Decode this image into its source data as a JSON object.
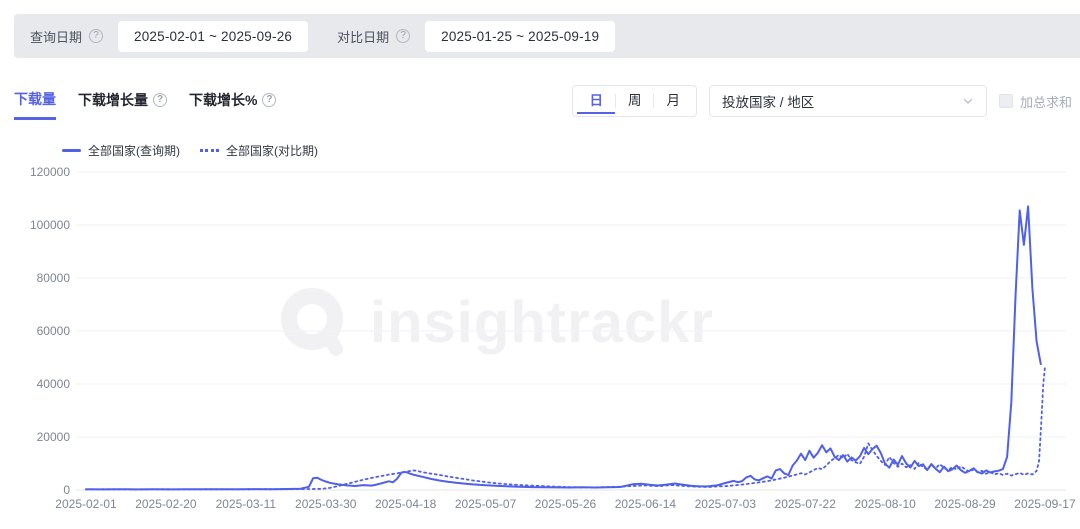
{
  "colors": {
    "accent": "#5663e6",
    "line": "#5060e8",
    "topbar_bg": "#e8e9ec",
    "grid": "#f1f2f5",
    "axis_text": "#7e8594",
    "watermark": "#f1f1f3"
  },
  "filters": {
    "query_label": "查询日期",
    "query_value": "2025-02-01  ~  2025-09-26",
    "compare_label": "对比日期",
    "compare_value": "2025-01-25  ~  2025-09-19"
  },
  "toolbar": {
    "tabs": [
      {
        "label": "下载量",
        "active": true,
        "has_help": false
      },
      {
        "label": "下载增长量",
        "active": false,
        "has_help": true
      },
      {
        "label": "下载增长%",
        "active": false,
        "has_help": true
      }
    ],
    "granularity": [
      {
        "label": "日",
        "active": true
      },
      {
        "label": "周",
        "active": false
      },
      {
        "label": "月",
        "active": false
      }
    ],
    "country_dropdown_placeholder": "投放国家 / 地区",
    "sum_checkbox_label": "加总求和",
    "sum_checkbox_checked": false
  },
  "legend": [
    {
      "label": "全部国家(查询期)",
      "style": "solid"
    },
    {
      "label": "全部国家(对比期)",
      "style": "dotted"
    }
  ],
  "watermark": "insightrackr",
  "chart_data": {
    "type": "line",
    "title": "",
    "xlabel": "",
    "ylabel": "",
    "grid": true,
    "legend_position": "top-left",
    "x_axis": {
      "unit": "day index from 2025-02-01",
      "domain": [
        0,
        233
      ],
      "tick_days": [
        0,
        19,
        38,
        57,
        76,
        95,
        114,
        133,
        152,
        171,
        190,
        209,
        228
      ],
      "tick_labels": [
        "2025-02-01",
        "2025-02-20",
        "2025-03-11",
        "2025-03-30",
        "2025-04-18",
        "2025-05-07",
        "2025-05-26",
        "2025-06-14",
        "2025-07-03",
        "2025-07-22",
        "2025-08-10",
        "2025-08-29",
        "2025-09-17"
      ]
    },
    "y_axis": {
      "range": [
        0,
        120000
      ],
      "ticks": [
        0,
        20000,
        40000,
        60000,
        80000,
        100000,
        120000
      ]
    },
    "series": [
      {
        "name": "全部国家(查询期)",
        "style": "solid",
        "points": [
          [
            0,
            260
          ],
          [
            4,
            210
          ],
          [
            8,
            300
          ],
          [
            12,
            240
          ],
          [
            16,
            280
          ],
          [
            20,
            220
          ],
          [
            24,
            300
          ],
          [
            28,
            260
          ],
          [
            32,
            310
          ],
          [
            36,
            280
          ],
          [
            40,
            340
          ],
          [
            44,
            300
          ],
          [
            48,
            380
          ],
          [
            51,
            500
          ],
          [
            53,
            1200
          ],
          [
            54,
            4400
          ],
          [
            55,
            4600
          ],
          [
            56,
            3800
          ],
          [
            57,
            3200
          ],
          [
            58,
            2700
          ],
          [
            60,
            2100
          ],
          [
            62,
            1750
          ],
          [
            64,
            1500
          ],
          [
            66,
            1850
          ],
          [
            68,
            1650
          ],
          [
            70,
            2400
          ],
          [
            72,
            3300
          ],
          [
            73,
            2900
          ],
          [
            74,
            4300
          ],
          [
            75,
            6600
          ],
          [
            76,
            6800
          ],
          [
            77,
            6200
          ],
          [
            78,
            5700
          ],
          [
            80,
            5000
          ],
          [
            82,
            4200
          ],
          [
            84,
            3600
          ],
          [
            86,
            3100
          ],
          [
            88,
            2700
          ],
          [
            90,
            2400
          ],
          [
            92,
            2100
          ],
          [
            95,
            1800
          ],
          [
            98,
            1550
          ],
          [
            100,
            1400
          ],
          [
            103,
            1250
          ],
          [
            106,
            1100
          ],
          [
            109,
            1050
          ],
          [
            112,
            1000
          ],
          [
            115,
            950
          ],
          [
            118,
            1050
          ],
          [
            121,
            950
          ],
          [
            124,
            1050
          ],
          [
            127,
            1150
          ],
          [
            129,
            1800
          ],
          [
            130,
            2200
          ],
          [
            132,
            2350
          ],
          [
            134,
            1950
          ],
          [
            136,
            1700
          ],
          [
            138,
            2050
          ],
          [
            140,
            2450
          ],
          [
            142,
            1950
          ],
          [
            144,
            1550
          ],
          [
            146,
            1350
          ],
          [
            148,
            1450
          ],
          [
            150,
            1750
          ],
          [
            152,
            2650
          ],
          [
            154,
            3450
          ],
          [
            155,
            2950
          ],
          [
            156,
            3350
          ],
          [
            157,
            4750
          ],
          [
            158,
            5350
          ],
          [
            159,
            3950
          ],
          [
            160,
            3650
          ],
          [
            161,
            4450
          ],
          [
            162,
            5150
          ],
          [
            163,
            4350
          ],
          [
            164,
            7400
          ],
          [
            165,
            7900
          ],
          [
            166,
            6250
          ],
          [
            167,
            5650
          ],
          [
            168,
            9200
          ],
          [
            169,
            11100
          ],
          [
            170,
            13700
          ],
          [
            171,
            11300
          ],
          [
            172,
            14800
          ],
          [
            173,
            12200
          ],
          [
            174,
            14000
          ],
          [
            175,
            16900
          ],
          [
            176,
            14200
          ],
          [
            177,
            15700
          ],
          [
            178,
            12500
          ],
          [
            179,
            11300
          ],
          [
            180,
            13200
          ],
          [
            181,
            10700
          ],
          [
            182,
            12300
          ],
          [
            183,
            11100
          ],
          [
            184,
            12700
          ],
          [
            185,
            15900
          ],
          [
            186,
            13500
          ],
          [
            187,
            15500
          ],
          [
            188,
            16700
          ],
          [
            189,
            13900
          ],
          [
            190,
            9900
          ],
          [
            191,
            8400
          ],
          [
            192,
            11500
          ],
          [
            193,
            9500
          ],
          [
            194,
            12800
          ],
          [
            195,
            10000
          ],
          [
            196,
            8500
          ],
          [
            197,
            11000
          ],
          [
            198,
            9000
          ],
          [
            199,
            9700
          ],
          [
            200,
            7500
          ],
          [
            201,
            9800
          ],
          [
            202,
            8000
          ],
          [
            203,
            6700
          ],
          [
            204,
            8800
          ],
          [
            205,
            7100
          ],
          [
            206,
            7800
          ],
          [
            207,
            9200
          ],
          [
            208,
            7500
          ],
          [
            209,
            6500
          ],
          [
            210,
            7200
          ],
          [
            211,
            8200
          ],
          [
            212,
            6800
          ],
          [
            213,
            6200
          ],
          [
            214,
            7400
          ],
          [
            215,
            6600
          ],
          [
            216,
            7000
          ],
          [
            217,
            7300
          ],
          [
            218,
            7900
          ],
          [
            219,
            12500
          ],
          [
            220,
            33000
          ],
          [
            221,
            73000
          ],
          [
            222,
            105500
          ],
          [
            223,
            92500
          ],
          [
            224,
            107000
          ],
          [
            225,
            76000
          ],
          [
            226,
            56000
          ],
          [
            227,
            47500
          ]
        ]
      },
      {
        "name": "全部国家(对比期)",
        "style": "dotted",
        "points": [
          [
            0,
            210
          ],
          [
            6,
            260
          ],
          [
            12,
            200
          ],
          [
            18,
            260
          ],
          [
            24,
            220
          ],
          [
            30,
            270
          ],
          [
            36,
            240
          ],
          [
            42,
            300
          ],
          [
            48,
            320
          ],
          [
            53,
            360
          ],
          [
            56,
            420
          ],
          [
            58,
            800
          ],
          [
            60,
            1500
          ],
          [
            62,
            2300
          ],
          [
            64,
            3100
          ],
          [
            66,
            3900
          ],
          [
            68,
            4600
          ],
          [
            70,
            5200
          ],
          [
            72,
            5800
          ],
          [
            74,
            6300
          ],
          [
            76,
            6900
          ],
          [
            78,
            7400
          ],
          [
            79,
            7100
          ],
          [
            80,
            6700
          ],
          [
            82,
            6200
          ],
          [
            84,
            5700
          ],
          [
            86,
            5100
          ],
          [
            88,
            4600
          ],
          [
            90,
            4100
          ],
          [
            92,
            3600
          ],
          [
            94,
            3200
          ],
          [
            96,
            2800
          ],
          [
            98,
            2500
          ],
          [
            100,
            2200
          ],
          [
            103,
            1900
          ],
          [
            106,
            1650
          ],
          [
            109,
            1450
          ],
          [
            112,
            1250
          ],
          [
            115,
            1100
          ],
          [
            118,
            1000
          ],
          [
            121,
            1000
          ],
          [
            124,
            1100
          ],
          [
            127,
            1250
          ],
          [
            130,
            1500
          ],
          [
            133,
            1750
          ],
          [
            136,
            1450
          ],
          [
            139,
            1850
          ],
          [
            142,
            1550
          ],
          [
            145,
            1250
          ],
          [
            148,
            1150
          ],
          [
            150,
            1350
          ],
          [
            152,
            1450
          ],
          [
            154,
            1750
          ],
          [
            156,
            2050
          ],
          [
            158,
            2450
          ],
          [
            160,
            2850
          ],
          [
            162,
            3350
          ],
          [
            164,
            3950
          ],
          [
            166,
            4650
          ],
          [
            168,
            5450
          ],
          [
            170,
            6350
          ],
          [
            171,
            5850
          ],
          [
            172,
            6650
          ],
          [
            173,
            7450
          ],
          [
            174,
            8350
          ],
          [
            175,
            7850
          ],
          [
            176,
            9250
          ],
          [
            177,
            10850
          ],
          [
            178,
            12050
          ],
          [
            179,
            13250
          ],
          [
            180,
            11950
          ],
          [
            181,
            13650
          ],
          [
            182,
            11250
          ],
          [
            183,
            10450
          ],
          [
            184,
            9850
          ],
          [
            185,
            12550
          ],
          [
            186,
            17600
          ],
          [
            187,
            15100
          ],
          [
            188,
            12850
          ],
          [
            189,
            10950
          ],
          [
            190,
            9450
          ],
          [
            191,
            12450
          ],
          [
            192,
            10250
          ],
          [
            193,
            8750
          ],
          [
            194,
            9950
          ],
          [
            195,
            8550
          ],
          [
            196,
            9350
          ],
          [
            197,
            7950
          ],
          [
            198,
            10250
          ],
          [
            199,
            8650
          ],
          [
            200,
            7750
          ],
          [
            201,
            9450
          ],
          [
            202,
            8150
          ],
          [
            203,
            9750
          ],
          [
            204,
            8350
          ],
          [
            205,
            7450
          ],
          [
            206,
            8750
          ],
          [
            207,
            7650
          ],
          [
            208,
            8950
          ],
          [
            209,
            7850
          ],
          [
            210,
            6950
          ],
          [
            211,
            7750
          ],
          [
            212,
            6650
          ],
          [
            213,
            7250
          ],
          [
            214,
            6150
          ],
          [
            215,
            6750
          ],
          [
            216,
            5850
          ],
          [
            217,
            6350
          ],
          [
            218,
            5650
          ],
          [
            219,
            6150
          ],
          [
            220,
            5450
          ],
          [
            221,
            5950
          ],
          [
            222,
            6450
          ],
          [
            223,
            5750
          ],
          [
            224,
            6250
          ],
          [
            225,
            5850
          ],
          [
            226,
            7200
          ],
          [
            226.6,
            11000
          ],
          [
            227.1,
            25000
          ],
          [
            227.6,
            40000
          ],
          [
            228,
            46500
          ]
        ]
      }
    ]
  }
}
